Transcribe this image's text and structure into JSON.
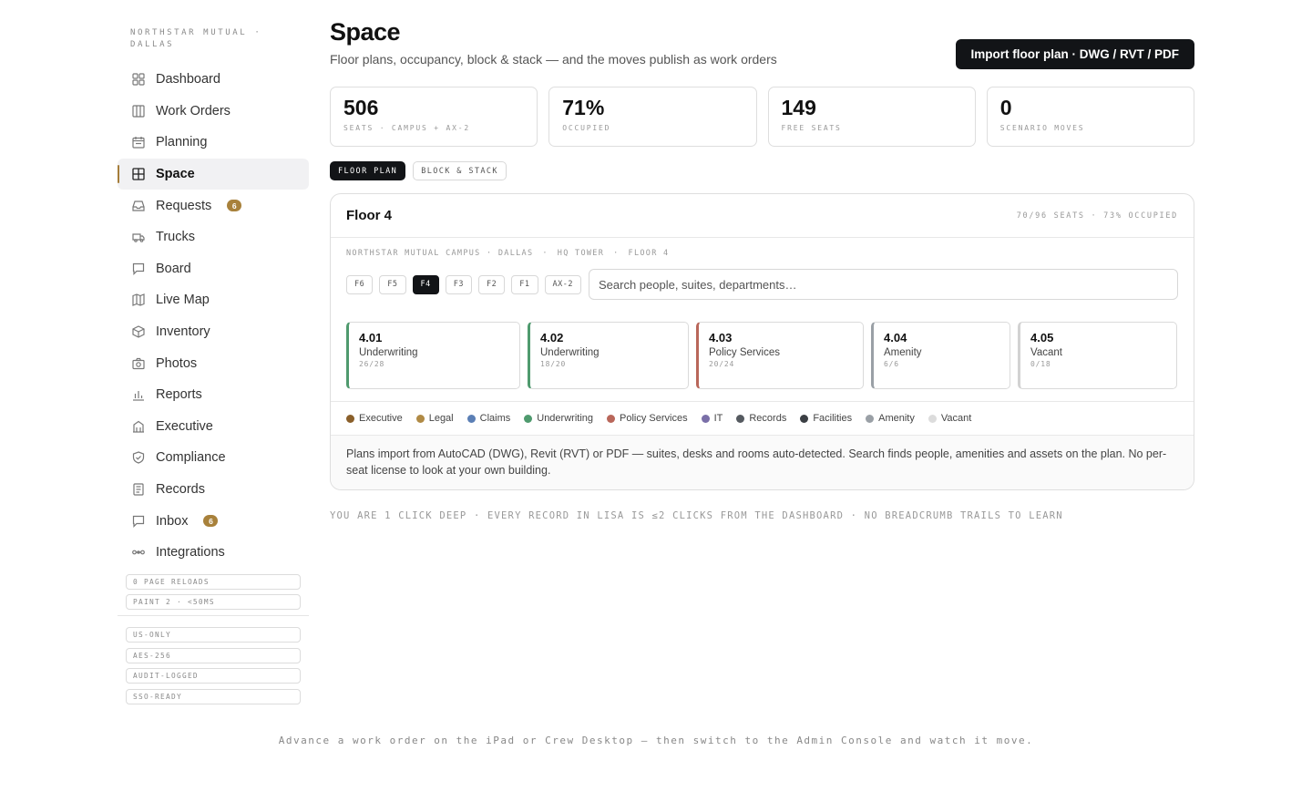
{
  "sidebar": {
    "org": "NORTHSTAR MUTUAL · DALLAS",
    "items": [
      {
        "label": "Dashboard",
        "icon": "grid-icon"
      },
      {
        "label": "Work Orders",
        "icon": "columns-icon"
      },
      {
        "label": "Planning",
        "icon": "calendar-icon"
      },
      {
        "label": "Space",
        "icon": "floorplan-icon",
        "active": true
      },
      {
        "label": "Requests",
        "icon": "inbox-tray-icon",
        "badge": "6"
      },
      {
        "label": "Trucks",
        "icon": "truck-icon"
      },
      {
        "label": "Board",
        "icon": "chat-icon"
      },
      {
        "label": "Live Map",
        "icon": "map-icon"
      },
      {
        "label": "Inventory",
        "icon": "box-icon"
      },
      {
        "label": "Photos",
        "icon": "camera-icon"
      },
      {
        "label": "Reports",
        "icon": "bar-chart-icon"
      },
      {
        "label": "Executive",
        "icon": "building-icon"
      },
      {
        "label": "Compliance",
        "icon": "shield-icon"
      },
      {
        "label": "Records",
        "icon": "document-icon"
      },
      {
        "label": "Inbox",
        "icon": "chat-icon",
        "badge": "6"
      },
      {
        "label": "Integrations",
        "icon": "link-icon"
      }
    ],
    "perf_chips": [
      "0 PAGE RELOADS",
      "PAINT 2 · <50MS"
    ],
    "security_chips": [
      "US-ONLY",
      "AES-256",
      "AUDIT-LOGGED",
      "SSO-READY"
    ]
  },
  "header": {
    "title": "Space",
    "subtitle": "Floor plans, occupancy, block & stack — and the moves publish as work orders",
    "import_label": "Import floor plan · DWG / RVT / PDF"
  },
  "stats": [
    {
      "value": "506",
      "label": "SEATS · CAMPUS + AX-2"
    },
    {
      "value": "71%",
      "label": "OCCUPIED"
    },
    {
      "value": "149",
      "label": "FREE SEATS"
    },
    {
      "value": "0",
      "label": "SCENARIO MOVES"
    }
  ],
  "tabs": [
    {
      "label": "FLOOR PLAN",
      "active": true
    },
    {
      "label": "BLOCK & STACK",
      "active": false
    }
  ],
  "panel": {
    "title": "Floor 4",
    "meta": "70/96 SEATS · 73% OCCUPIED",
    "breadcrumb": [
      "NORTHSTAR MUTUAL CAMPUS · DALLAS",
      "·",
      "HQ TOWER",
      "·",
      "FLOOR 4"
    ],
    "floors": [
      {
        "label": "F6",
        "active": false
      },
      {
        "label": "F5",
        "active": false
      },
      {
        "label": "F4",
        "active": true
      },
      {
        "label": "F3",
        "active": false
      },
      {
        "label": "F2",
        "active": false
      },
      {
        "label": "F1",
        "active": false
      },
      {
        "label": "AX-2",
        "active": false
      }
    ],
    "search_placeholder": "Search people, suites, departments…",
    "suites": [
      {
        "id": "4.01",
        "dept": "Underwriting",
        "count": "26/28",
        "color": "#4f9a6e"
      },
      {
        "id": "4.02",
        "dept": "Underwriting",
        "count": "18/20",
        "color": "#4f9a6e"
      },
      {
        "id": "4.03",
        "dept": "Policy Services",
        "count": "20/24",
        "color": "#b9675a"
      },
      {
        "id": "4.04",
        "dept": "Amenity",
        "count": "6/6",
        "color": "#9aa0a6"
      },
      {
        "id": "4.05",
        "dept": "Vacant",
        "count": "0/18",
        "color": "#d2d2d2"
      }
    ],
    "legend": [
      {
        "label": "Executive",
        "color": "#8a5f2a"
      },
      {
        "label": "Legal",
        "color": "#b08a45"
      },
      {
        "label": "Claims",
        "color": "#5b7fb5"
      },
      {
        "label": "Underwriting",
        "color": "#4f9a6e"
      },
      {
        "label": "Policy Services",
        "color": "#b9675a"
      },
      {
        "label": "IT",
        "color": "#7a6fa8"
      },
      {
        "label": "Records",
        "color": "#555a60"
      },
      {
        "label": "Facilities",
        "color": "#3b3f44"
      },
      {
        "label": "Amenity",
        "color": "#9aa0a6"
      },
      {
        "label": "Vacant",
        "color": "#dcdcdc"
      }
    ],
    "note": "Plans import from AutoCAD (DWG), Revit (RVT) or PDF — suites, desks and rooms auto-detected. Search finds people, amenities and assets on the plan. No per-seat license to look at your own building."
  },
  "depth_note": "YOU ARE 1 CLICK DEEP · EVERY RECORD IN LISA IS ≤2 CLICKS FROM THE DASHBOARD · NO BREADCRUMB TRAILS TO LEARN",
  "footer": "Advance a work order on the iPad or Crew Desktop — then switch to the Admin Console and watch it move."
}
